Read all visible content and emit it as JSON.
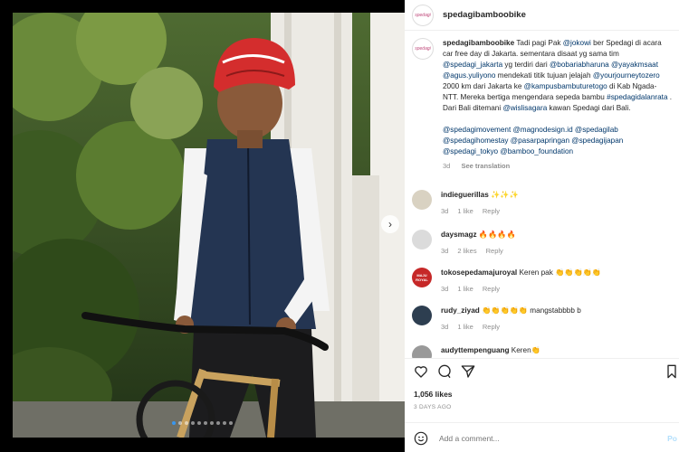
{
  "account": {
    "username": "spedagibamboobike",
    "avatar_text": "spedagi"
  },
  "caption": {
    "username": "spedagibamboobike",
    "segments": [
      {
        "t": "Tadi pagi Pak "
      },
      {
        "t": "@jokowi",
        "link": true
      },
      {
        "t": " ber Spedagi di acara car free day di Jakarta. sementara disaat yg sama tim "
      },
      {
        "t": "@spedagi_jakarta",
        "link": true
      },
      {
        "t": " yg terdiri dari "
      },
      {
        "t": "@bobariabharuna",
        "link": true
      },
      {
        "t": " "
      },
      {
        "t": "@yayakmsaat",
        "link": true
      },
      {
        "t": " "
      },
      {
        "t": "@agus.yuliyono",
        "link": true
      },
      {
        "t": " mendekati titik tujuan jelajah "
      },
      {
        "t": "@yourjourneytozero",
        "link": true
      },
      {
        "t": " 2000 km dari Jakarta ke "
      },
      {
        "t": "@kampusbambuturetogo",
        "link": true
      },
      {
        "t": " di Kab Ngada- NTT. Mereka bertiga mengendara sepeda bambu "
      },
      {
        "t": "#spedagidalanrata",
        "link": true
      },
      {
        "t": " . Dari Bali ditemani "
      },
      {
        "t": "@wislisagara",
        "link": true
      },
      {
        "t": " kawan Spedagi dari Bali."
      }
    ],
    "tags": [
      {
        "t": "@spedagimovement",
        "link": true
      },
      {
        "t": " "
      },
      {
        "t": "@magnodesign.id",
        "link": true
      },
      {
        "t": " "
      },
      {
        "t": "@spedagilab",
        "link": true
      },
      {
        "t": " "
      },
      {
        "t": "@spedagihomestay",
        "link": true
      },
      {
        "t": " "
      },
      {
        "t": "@pasarpapringan",
        "link": true
      },
      {
        "t": " "
      },
      {
        "t": "@spedagijapan",
        "link": true
      },
      {
        "t": " "
      },
      {
        "t": "@spedagi_tokyo",
        "link": true
      },
      {
        "t": " "
      },
      {
        "t": "@bamboo_foundation",
        "link": true
      }
    ],
    "age": "3d",
    "see_translation": "See translation"
  },
  "comments": [
    {
      "username": "indieguerillas",
      "text": "✨✨✨",
      "age": "3d",
      "likes": "1 like",
      "reply": "Reply",
      "avatar_color": "#d9d2c2"
    },
    {
      "username": "daysmagz",
      "text": "🔥🔥🔥🔥",
      "age": "3d",
      "likes": "2 likes",
      "reply": "Reply",
      "avatar_color": "#dbdbdb"
    },
    {
      "username": "tokosepedamajuroyal",
      "text": "Keren pak 👏👏👏👏👏",
      "age": "3d",
      "likes": "1 like",
      "reply": "Reply",
      "avatar_color": "#c62828",
      "avatar_text": "MAJU ROYAL"
    },
    {
      "username": "rudy_ziyad",
      "text": "👏👏👏👏👏 mangstabbbb b",
      "age": "3d",
      "likes": "1 like",
      "reply": "Reply",
      "avatar_color": "#2d3e50"
    },
    {
      "username": "audyttempenguang",
      "text": "Keren👏",
      "age": "",
      "likes": "",
      "reply": "",
      "avatar_color": "#999"
    }
  ],
  "post": {
    "likes": "1,056 likes",
    "time": "3 DAYS AGO"
  },
  "add_comment": {
    "placeholder": "Add a comment...",
    "post_label": "Po"
  },
  "photo": {
    "dots": 10,
    "active_dot": 0
  }
}
